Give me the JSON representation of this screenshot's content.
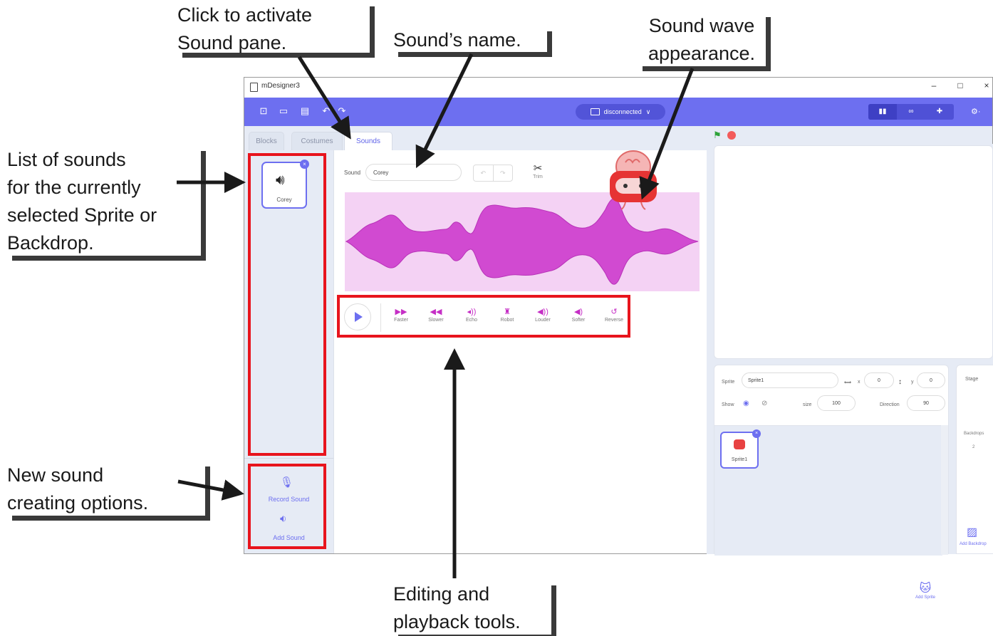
{
  "window": {
    "title": "mDesigner3",
    "controls": [
      "–",
      "□",
      "×"
    ]
  },
  "toolbar": {
    "connection_label": "disconnected",
    "connection_chevron": "∨",
    "mode_buttons": [
      "▮▮",
      "∞",
      "✚"
    ],
    "settings": "⚙·"
  },
  "tabs": {
    "blocks": "Blocks",
    "costumes": "Costumes",
    "sounds": "Sounds"
  },
  "sound_list": {
    "items": [
      {
        "name": "Corey"
      }
    ],
    "record_label": "Record Sound",
    "add_label": "Add Sound"
  },
  "editor": {
    "sound_label": "Sound",
    "sound_name": "Corey",
    "trim_label": "Trim",
    "waveform_color": "#d14ad1",
    "tools": [
      {
        "label": "Faster",
        "icon": "fast-forward-icon"
      },
      {
        "label": "Slower",
        "icon": "rewind-icon"
      },
      {
        "label": "Echo",
        "icon": "echo-icon"
      },
      {
        "label": "Robot",
        "icon": "robot-icon"
      },
      {
        "label": "Louder",
        "icon": "louder-icon"
      },
      {
        "label": "Softer",
        "icon": "softer-icon"
      },
      {
        "label": "Reverse",
        "icon": "reverse-icon"
      }
    ]
  },
  "sprite_info": {
    "sprite_label": "Sprite",
    "sprite_name": "Sprite1",
    "x_label": "x",
    "x_value": "0",
    "y_label": "y",
    "y_value": "0",
    "show_label": "Show",
    "size_label": "size",
    "size_value": "100",
    "direction_label": "Direction",
    "direction_value": "90",
    "sprites": [
      {
        "name": "Sprite1"
      }
    ],
    "add_sprite_label": "Add Sprite"
  },
  "stage_panel": {
    "title": "Stage",
    "backdrops_label": "Backdrops",
    "backdrops_count": "2",
    "add_backdrop_label": "Add Backdrop"
  },
  "annotations": {
    "activate_sound_pane": [
      "Click to activate",
      "Sound pane."
    ],
    "sounds_name": "Sound’s name.",
    "sound_wave": [
      "Sound wave",
      "appearance."
    ],
    "list_of_sounds": [
      "List of sounds",
      "for the currently",
      "selected Sprite or",
      "Backdrop."
    ],
    "new_sound": [
      "New sound",
      "creating options."
    ],
    "editing_tools": [
      "Editing and",
      "playback tools."
    ]
  },
  "colors": {
    "accent": "#6d6ff0",
    "highlight": "#e8141d",
    "effect_icons": "#c52ec5"
  }
}
